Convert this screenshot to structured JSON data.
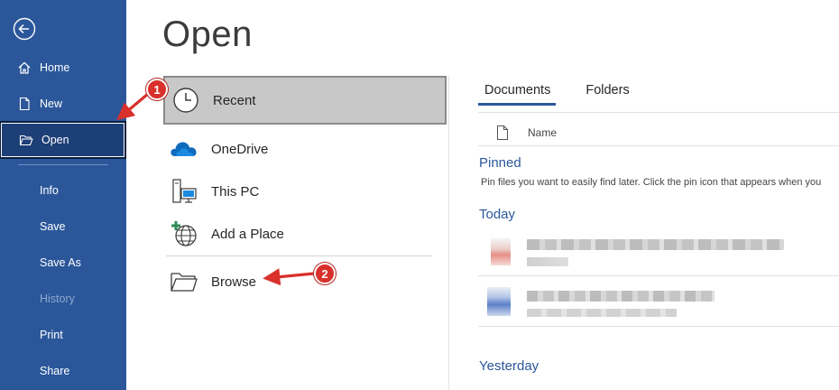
{
  "nav": {
    "back_icon": "back-arrow-icon",
    "items": [
      {
        "label": "Home",
        "icon": "home-icon"
      },
      {
        "label": "New",
        "icon": "new-document-icon"
      },
      {
        "label": "Open",
        "icon": "open-folder-icon"
      },
      {
        "label": "Info"
      },
      {
        "label": "Save"
      },
      {
        "label": "Save As"
      },
      {
        "label": "History"
      },
      {
        "label": "Print"
      },
      {
        "label": "Share"
      }
    ]
  },
  "page": {
    "title": "Open"
  },
  "locations": [
    {
      "label": "Recent",
      "icon": "clock-icon"
    },
    {
      "label": "OneDrive",
      "icon": "onedrive-cloud-icon"
    },
    {
      "label": "This PC",
      "icon": "computer-icon"
    },
    {
      "label": "Add a Place",
      "icon": "add-place-globe-icon"
    },
    {
      "label": "Browse",
      "icon": "folder-icon"
    }
  ],
  "tabs": [
    {
      "label": "Documents"
    },
    {
      "label": "Folders"
    }
  ],
  "table_header": {
    "name": "Name"
  },
  "sections": {
    "pinned": "Pinned",
    "pinned_note": "Pin files you want to easily find later. Click the pin icon that appears when you",
    "today": "Today",
    "yesterday": "Yesterday"
  },
  "annotations": {
    "step1": "1",
    "step2": "2"
  },
  "colors": {
    "nav_bg": "#2b579a",
    "accent": "#2b579a",
    "annotation": "#d9302c"
  }
}
